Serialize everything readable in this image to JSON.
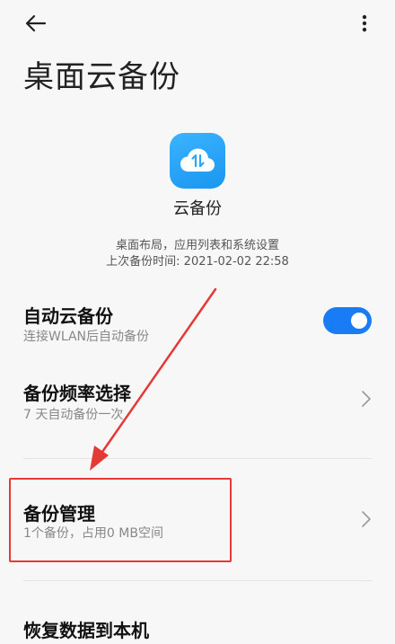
{
  "header": {
    "title": "桌面云备份",
    "back_icon": "arrow-left-icon",
    "more_icon": "more-vertical-icon"
  },
  "app": {
    "name": "云备份",
    "description_line1": "桌面布局，应用列表和系统设置",
    "description_line2": "上次备份时间: 2021-02-02 22:58",
    "icon": "cloud-sync-icon",
    "icon_color": "#2aa7fb"
  },
  "settings": {
    "auto_backup": {
      "title": "自动云备份",
      "subtitle": "连接WLAN后自动备份",
      "enabled": true,
      "toggle_color": "#1a7cf5"
    },
    "frequency": {
      "title": "备份频率选择",
      "subtitle": "7 天自动备份一次"
    },
    "manage": {
      "title": "备份管理",
      "subtitle": "1个备份，占用0 MB空间"
    },
    "restore": {
      "title": "恢复数据到本机"
    }
  },
  "annotation": {
    "highlight_color": "#e53935",
    "arrow_color": "#e53935"
  }
}
